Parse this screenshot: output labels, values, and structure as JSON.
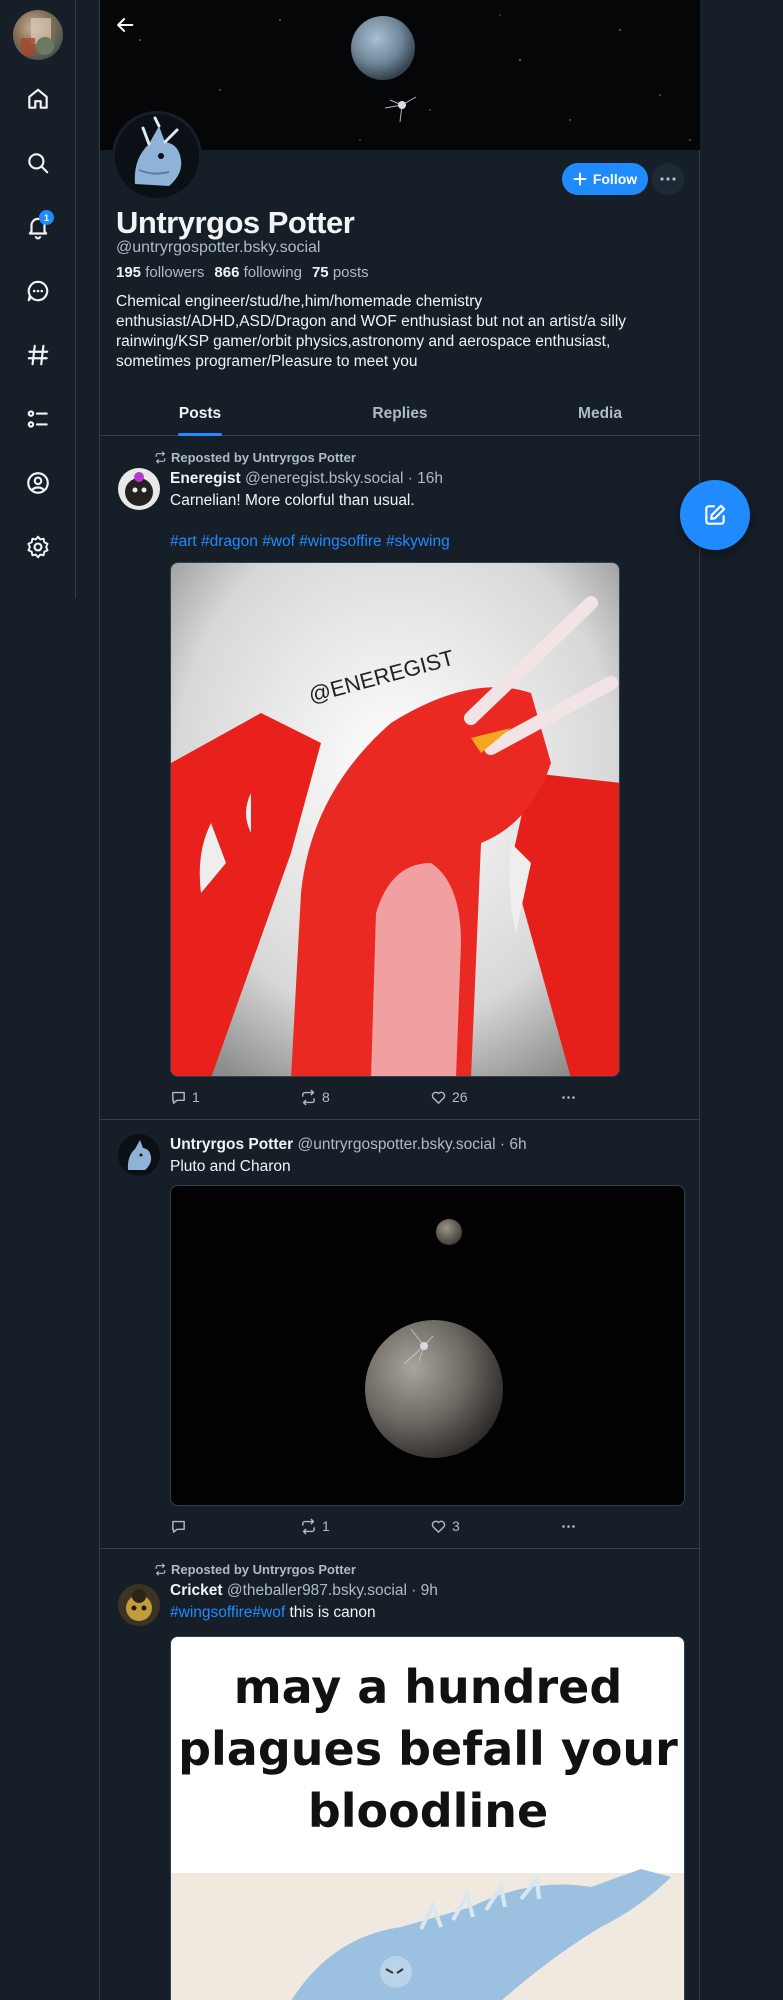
{
  "nav": {
    "notifications_count": "1",
    "items": [
      "home",
      "search",
      "notifications",
      "chat",
      "feeds",
      "lists",
      "profile",
      "settings"
    ]
  },
  "profile": {
    "display_name": "Untryrgos Potter",
    "handle": "@untryrgospotter.bsky.social",
    "followers_count": "195",
    "followers_label": "followers",
    "following_count": "866",
    "following_label": "following",
    "posts_count": "75",
    "posts_label": "posts",
    "bio": "Chemical engineer/stud/he,him/homemade chemistry enthusiast/ADHD,ASD/Dragon and WOF enthusiast but not an artist/a silly rainwing/KSP gamer/orbit physics,astronomy and aerospace enthusiast, sometimes programer/Pleasure to meet you",
    "follow_label": "Follow"
  },
  "tabs": [
    {
      "label": "Posts",
      "active": true
    },
    {
      "label": "Replies",
      "active": false
    },
    {
      "label": "Media",
      "active": false
    }
  ],
  "posts": [
    {
      "repost_label": "Reposted by Untryrgos Potter",
      "author": "Eneregist",
      "meta": "@eneregist.bsky.social · 16h",
      "text": "Carnelian! More colorful than usual.",
      "tags": "#art #dragon #wof #wingsoffire #skywing",
      "image_caption": "@ENEREGIST",
      "replies": "1",
      "reposts": "8",
      "likes": "26"
    },
    {
      "author": "Untryrgos Potter",
      "meta": "@untryrgospotter.bsky.social · 6h",
      "text": "Pluto and Charon",
      "replies": "",
      "reposts": "1",
      "likes": "3"
    },
    {
      "repost_label": "Reposted by Untryrgos Potter",
      "author": "Cricket",
      "meta": "@theballer987.bsky.social · 9h",
      "tags": "#wingsoffire#wof",
      "text": "this is canon",
      "meme_line1": "may a hundred",
      "meme_line2": "plagues befall your",
      "meme_line3": "bloodline"
    }
  ],
  "colors": {
    "background": "#161e27",
    "accent": "#208bfe",
    "muted": "#aebbc9",
    "border": "#2e4052"
  }
}
